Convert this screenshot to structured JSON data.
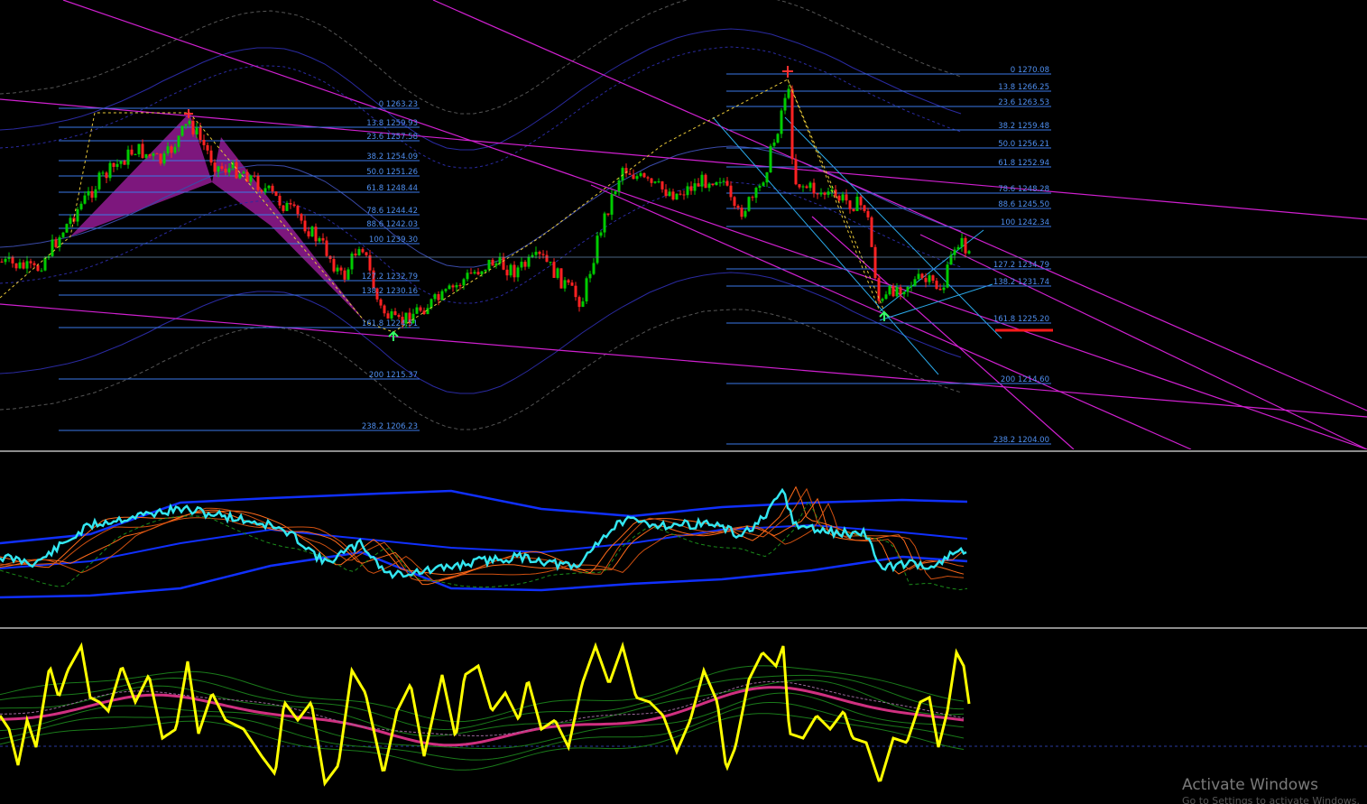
{
  "colors": {
    "background": "#000000",
    "fib_line": "#3a78e8",
    "fib_text": "#4f8ff0",
    "bull_candle": "#00cc00",
    "bear_candle": "#ff2222",
    "trendline": "#d020d0",
    "harmonic_fill": "#8b1a8b",
    "envelope": "#2a2aa0",
    "osc_main": "#33e6f0",
    "osc_band": "#1030ff",
    "osc2_main": "#ffff00",
    "osc2_signal": "#d03080"
  },
  "icons": {
    "buy_arrow": "up-arrow-icon",
    "sell_arrow": "down-arrow-icon"
  },
  "fib_left": [
    {
      "level": "0",
      "price": "1263.23"
    },
    {
      "level": "13.8",
      "price": "1259.93"
    },
    {
      "level": "23.6",
      "price": "1257.58"
    },
    {
      "level": "38.2",
      "price": "1254.09"
    },
    {
      "level": "50.0",
      "price": "1251.26"
    },
    {
      "level": "61.8",
      "price": "1248.44"
    },
    {
      "level": "78.6",
      "price": "1244.42"
    },
    {
      "level": "88.6",
      "price": "1242.03"
    },
    {
      "level": "100",
      "price": "1239.30"
    },
    {
      "level": "127.2",
      "price": "1232.79"
    },
    {
      "level": "138.2",
      "price": "1230.16"
    },
    {
      "level": "161.8",
      "price": "1224.51"
    },
    {
      "level": "200",
      "price": "1215.37"
    },
    {
      "level": "238.2",
      "price": "1206.23"
    }
  ],
  "fib_right": [
    {
      "level": "0",
      "price": "1270.08"
    },
    {
      "level": "13.8",
      "price": "1266.25"
    },
    {
      "level": "23.6",
      "price": "1263.53"
    },
    {
      "level": "38.2",
      "price": "1259.48"
    },
    {
      "level": "50.0",
      "price": "1256.21"
    },
    {
      "level": "61.8",
      "price": "1252.94"
    },
    {
      "level": "78.6",
      "price": "1248.28"
    },
    {
      "level": "88.6",
      "price": "1245.50"
    },
    {
      "level": "100",
      "price": "1242.34"
    },
    {
      "level": "127.2",
      "price": "1234.79"
    },
    {
      "level": "138.2",
      "price": "1231.74"
    },
    {
      "level": "161.8",
      "price": "1225.20"
    },
    {
      "level": "200",
      "price": "1214.60"
    },
    {
      "level": "238.2",
      "price": "1204.00"
    }
  ],
  "watermark": {
    "title": "Activate Windows",
    "subtitle": "Go to Settings to activate Windows."
  }
}
